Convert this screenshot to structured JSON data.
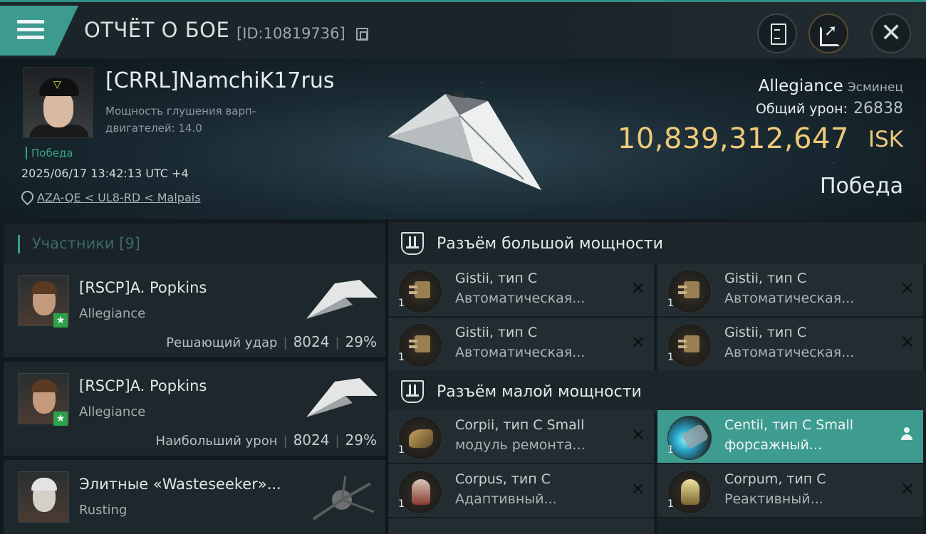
{
  "header": {
    "title": "ОТЧЁТ О БОЕ",
    "report_id": "[ID:10819736]"
  },
  "victim": {
    "name": "[CRRL]NamchiK17rus",
    "subtitle": "Мощность глушения варп-двигателей: 14.0",
    "result_small": "Победа",
    "datetime": "2025/06/17 13:42:13 UTC +4",
    "location": "AZA-QE < UL8-RD < Malpais",
    "ship_name": "Allegiance",
    "ship_class": "Эсминец",
    "total_damage_label": "Общий урон:",
    "total_damage": "26838",
    "isk_value": "10,839,312,647",
    "isk_unit": "ISK",
    "result_big": "Победа"
  },
  "participants": {
    "title": "Участники [9]",
    "items": [
      {
        "name": "[RSCP]A. Popkins",
        "ship": "Allegiance",
        "role": "Решающий удар",
        "damage": "8024",
        "percent": "29%"
      },
      {
        "name": "[RSCP]A. Popkins",
        "ship": "Allegiance",
        "role": "Наибольший урон",
        "damage": "8024",
        "percent": "29%"
      },
      {
        "name": "Элитные «Wasteseeker»...",
        "ship": "Rusting"
      }
    ]
  },
  "fitting": {
    "high_slot_title": "Разъём большой мощности",
    "low_slot_title": "Разъём малой мощности",
    "high_slots": [
      {
        "name": "Gistii, тип C",
        "type": "Автоматическая...",
        "qty": "1",
        "icon": "autocannon-icon"
      },
      {
        "name": "Gistii, тип C",
        "type": "Автоматическая...",
        "qty": "1",
        "icon": "autocannon-icon"
      },
      {
        "name": "Gistii, тип C",
        "type": "Автоматическая...",
        "qty": "1",
        "icon": "autocannon-icon"
      },
      {
        "name": "Gistii, тип C",
        "type": "Автоматическая...",
        "qty": "1",
        "icon": "autocannon-icon"
      }
    ],
    "low_slots": [
      {
        "name": "Corpii, тип C Small",
        "type": "модуль ремонта...",
        "qty": "1",
        "icon": "repair-module-icon"
      },
      {
        "name": "Centii, тип C Small",
        "type": "форсажный...",
        "qty": "1",
        "icon": "afterburner-icon",
        "active": true
      },
      {
        "name": "Corpus, тип C",
        "type": "Адаптивный...",
        "qty": "1",
        "icon": "adaptive-armor-icon"
      },
      {
        "name": "Corpum, тип C",
        "type": "Реактивный...",
        "qty": "1",
        "icon": "reactive-armor-icon"
      }
    ]
  },
  "colors": {
    "accent": "#3c9a8f",
    "isk": "#eec97a",
    "victory": "#3aa18b"
  }
}
